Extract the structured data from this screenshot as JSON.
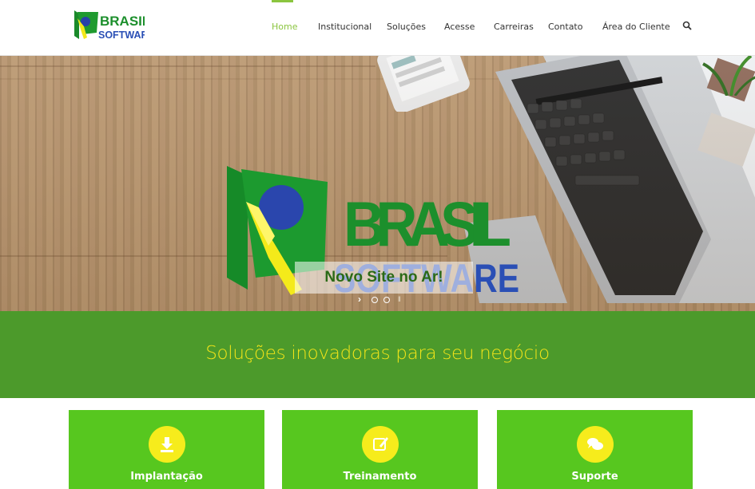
{
  "header": {
    "logo_text": {
      "line1": "BRASIL",
      "line2": "SOFTWARE"
    },
    "nav": [
      {
        "label": "Home",
        "active": true
      },
      {
        "label": "Institucional"
      },
      {
        "label": "Soluções"
      },
      {
        "label": "Acesse"
      },
      {
        "label": "Carreiras"
      },
      {
        "label": "Contato"
      },
      {
        "label": "Área do Cliente"
      }
    ],
    "search_icon": "search-icon"
  },
  "hero": {
    "logo_text": {
      "line1": "BRASIL",
      "line2": "SOFTWARE"
    },
    "caption": "Novo Site no Ar!",
    "slides_total": 2,
    "active_slide": 1
  },
  "band": {
    "tagline": "Soluções inovadoras para seu negócio"
  },
  "cards": [
    {
      "title": "Implantação",
      "icon": "download-icon"
    },
    {
      "title": "Treinamento",
      "icon": "edit-icon"
    },
    {
      "title": "Suporte",
      "icon": "chat-icon"
    }
  ],
  "colors": {
    "accent": "#8bc53f",
    "band": "#4c9a2b",
    "tagline": "#f1e419",
    "card": "#57c71f",
    "icon_circle": "#f6ec1c"
  }
}
